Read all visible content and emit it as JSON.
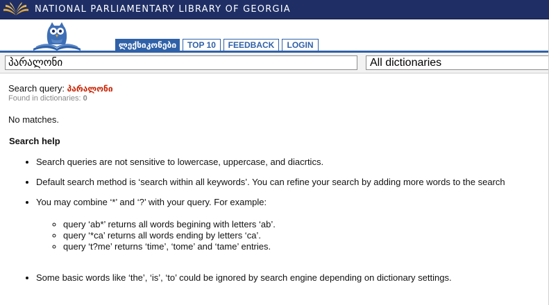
{
  "banner": {
    "title": "NATIONAL PARLIAMENTARY LIBRARY OF GEORGIA",
    "logo_icon": "library-book-logo-icon",
    "bg_color": "#1f2f66"
  },
  "nav": {
    "tabs": [
      {
        "label": "ლექსიკონები",
        "active": true
      },
      {
        "label": "TOP 10",
        "active": false
      },
      {
        "label": "FEEDBACK",
        "active": false
      },
      {
        "label": "LOGIN",
        "active": false
      }
    ],
    "accent_color": "#2f61a8"
  },
  "search": {
    "query_value": "პარალონი",
    "dictionary_selected": "All dictionaries"
  },
  "results": {
    "query_label": "Search query:",
    "query_value": "პარალონი",
    "found_label": "Found in dictionaries:",
    "found_count": "0",
    "no_matches": "No matches."
  },
  "help": {
    "title": "Search help",
    "items": [
      "Search queries are not sensitive to lowercase, uppercase, and diacrtics.",
      "Default search method is ‘search within all keywords’. You can refine your search by adding more words to the search",
      "You may combine ‘*’ and ‘?’ with your query. For example:",
      "Some basic words like ‘the’, ‘is’, ‘to’ could be ignored by search engine depending on dictionary settings."
    ],
    "examples": [
      "query ‘ab*’ returns all words begining with letters ‘ab’.",
      "query ‘*ca’ returns all words ending by letters ‘ca’.",
      "query ‘t?me’ returns ‘time’, ‘tome’ and ‘tame’ entries."
    ]
  }
}
